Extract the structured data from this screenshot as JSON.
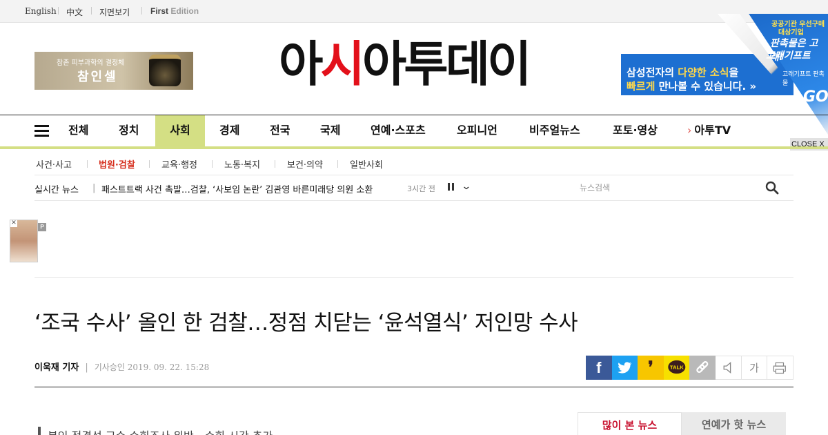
{
  "utility": {
    "english": "English",
    "chinese": "中文",
    "paper_view": "지면보기",
    "first": "First",
    "edition": "Edition"
  },
  "ads": {
    "left_line1": "참존 피부과학의 결정체",
    "left_line2": "참인셀",
    "right_line1_a": "삼성전자의 ",
    "right_line1_b": "다양한 소식",
    "right_line1_c": "을",
    "right_line2_a": "빠르게",
    "right_line2_b": " 만나볼 수 있습니다. »",
    "peel_l1": "공공기관 우선구매",
    "peel_l2": "대상기업",
    "peel_l3": "판촉물은 고래!",
    "peel_l4": "고래기프트",
    "peel_l5": "고래기프트 판촉물",
    "peel_go": "GO",
    "close": "CLOSE X",
    "float_badge": "P"
  },
  "logo": {
    "part1": "아",
    "part2": "시",
    "part3": "아투데이"
  },
  "nav": {
    "items": [
      {
        "label": "전체"
      },
      {
        "label": "정치"
      },
      {
        "label": "사회"
      },
      {
        "label": "경제"
      },
      {
        "label": "전국"
      },
      {
        "label": "국제"
      },
      {
        "label": "연예·스포츠"
      },
      {
        "label": "오피니언"
      },
      {
        "label": "비주얼뉴스"
      },
      {
        "label": "포토·영상"
      },
      {
        "label": "아투TV"
      }
    ],
    "active": "사회",
    "accent_color": "#d4df84"
  },
  "subnav": {
    "items": [
      {
        "label": "사건·사고"
      },
      {
        "label": "법원·검찰"
      },
      {
        "label": "교육·행정"
      },
      {
        "label": "노동·복지"
      },
      {
        "label": "보건·의약"
      },
      {
        "label": "일반사회"
      }
    ],
    "active": "법원·검찰"
  },
  "ticker": {
    "label": "실시간 뉴스",
    "separator": "|",
    "headline": "패스트트랙 사건 촉발…검찰, ‘사보임 논란’ 김관영 바른미래당 의원 소환",
    "ago": "3시간 전",
    "search_placeholder": "뉴스검색"
  },
  "article": {
    "title": "‘조국 수사’ 올인 한 검찰…정점 치닫는 ‘윤석열식’ 저인망 수사",
    "author": "이욱재 기자",
    "separator": "|",
    "date": "기사승인 2019. 09. 22. 15:28",
    "summary": "본인 적격성 교수 수회조사 위반…수회 시간 추가"
  },
  "share": {
    "font_size_label": "가"
  },
  "sidebar_tabs": [
    {
      "label": "많이 본 뉴스"
    },
    {
      "label": "연예가 핫 뉴스"
    }
  ]
}
